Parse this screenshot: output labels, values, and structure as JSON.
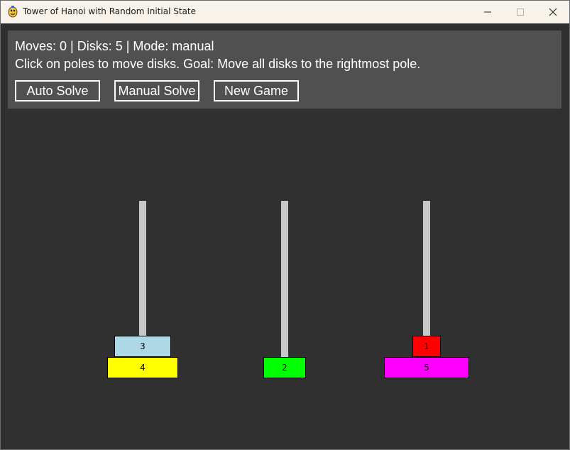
{
  "window": {
    "title": "Tower of Hanoi with Random Initial State",
    "app_icon": "pygame-snake-icon",
    "controls": {
      "minimize_icon": "minimize-icon",
      "maximize_icon": "maximize-icon",
      "close_icon": "close-icon"
    }
  },
  "status": {
    "line1": "Moves: 0 | Disks: 5 | Mode: manual",
    "line2": "Click on poles to move disks. Goal: Move all disks to the rightmost pole."
  },
  "buttons": {
    "auto_solve": "Auto Solve",
    "manual_solve": "Manual Solve",
    "new_game": "New Game"
  },
  "game_state": {
    "moves": 0,
    "disks_total": 5,
    "mode": "manual",
    "poles": [
      {
        "disks_bottom_to_top": [
          4,
          3
        ]
      },
      {
        "disks_bottom_to_top": [
          2
        ]
      },
      {
        "disks_bottom_to_top": [
          5,
          1
        ]
      }
    ]
  },
  "disks": {
    "1": {
      "label": "1",
      "color": "#ff0000"
    },
    "2": {
      "label": "2",
      "color": "#00ff00"
    },
    "3": {
      "label": "3",
      "color": "#add8e6"
    },
    "4": {
      "label": "4",
      "color": "#ffff00"
    },
    "5": {
      "label": "5",
      "color": "#ff00ff"
    }
  },
  "colors": {
    "background": "#303030",
    "panel": "#505050",
    "pole": "#c8c8c8",
    "text": "#ffffff",
    "titlebar": "#f7f3ea"
  }
}
